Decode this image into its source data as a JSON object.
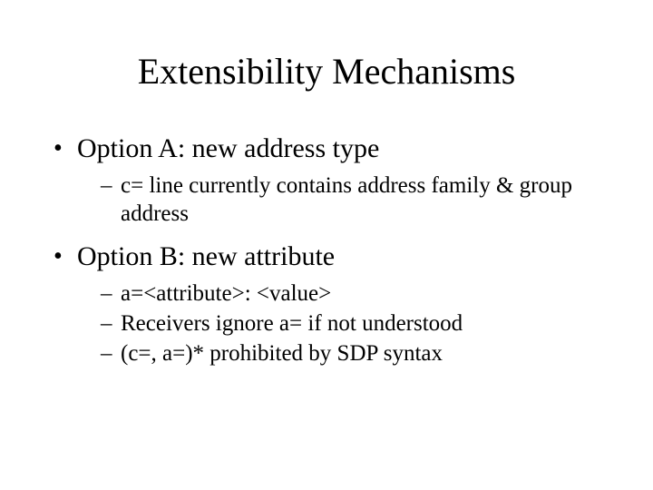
{
  "title": "Extensibility Mechanisms",
  "bullets": [
    {
      "text": "Option A: new address type",
      "sub": [
        "c= line currently contains address family & group address"
      ]
    },
    {
      "text": "Option B: new attribute",
      "sub": [
        "a=<attribute>: <value>",
        "Receivers ignore a= if not understood",
        "(c=, a=)* prohibited by SDP syntax"
      ]
    }
  ]
}
